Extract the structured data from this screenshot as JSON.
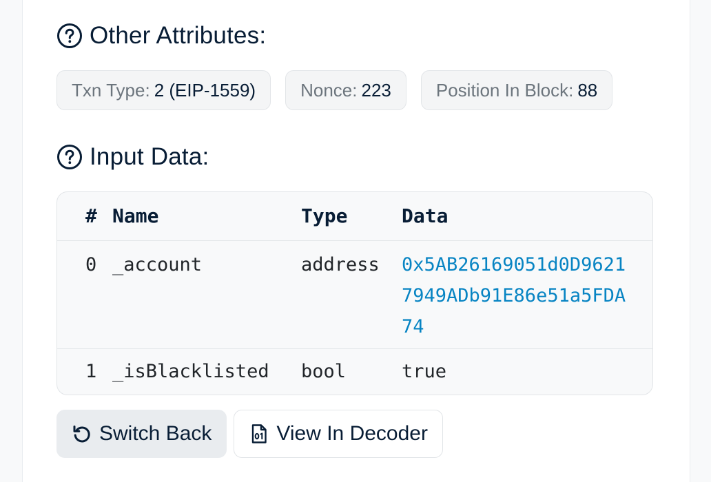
{
  "other_attributes": {
    "title": "Other Attributes:",
    "pills": [
      {
        "label": "Txn Type:",
        "value": "2 (EIP-1559)"
      },
      {
        "label": "Nonce:",
        "value": "223"
      },
      {
        "label": "Position In Block:",
        "value": "88"
      }
    ]
  },
  "input_data": {
    "title": "Input Data:",
    "headers": {
      "num": "#",
      "name": "Name",
      "type": "Type",
      "data": "Data"
    },
    "rows": [
      {
        "num": "0",
        "name": "_account",
        "type": "address",
        "data": "0x5AB26169051d0D96217949ADb91E86e51a5FDA74"
      },
      {
        "num": "1",
        "name": "_isBlacklisted",
        "type": "bool",
        "data": "true"
      }
    ]
  },
  "buttons": {
    "switch_back": "Switch Back",
    "view_in_decoder": "View In Decoder"
  },
  "colors": {
    "link": "#0784c3",
    "text": "#081d35",
    "muted": "#6c757d"
  }
}
